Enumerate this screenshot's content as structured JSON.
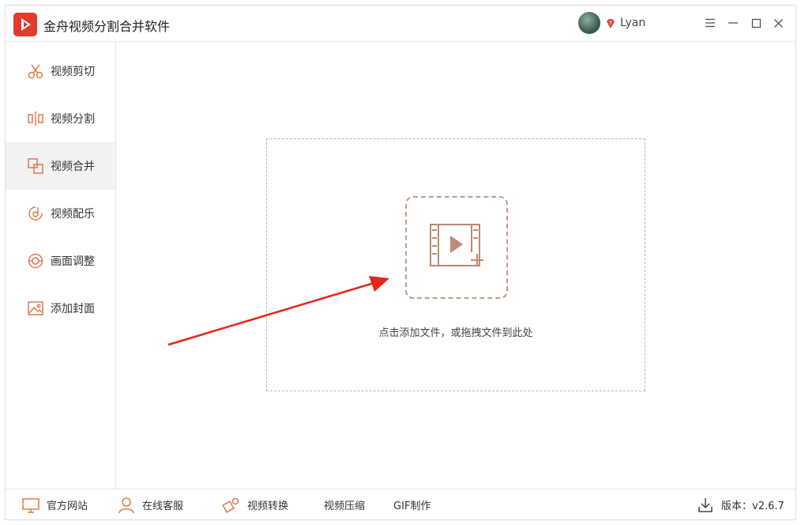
{
  "app": {
    "title": "金舟视频分割合并软件",
    "logo_icon": "play-logo-icon",
    "brand_color": "#e23a2c"
  },
  "user": {
    "name": "Lyan",
    "badge_icon": "vip-diamond-icon"
  },
  "window_controls": [
    "menu-icon",
    "minimize-icon",
    "maximize-icon",
    "close-icon"
  ],
  "sidebar": {
    "items": [
      {
        "label": "视频剪切",
        "icon": "scissors-icon"
      },
      {
        "label": "视频分割",
        "icon": "split-icon"
      },
      {
        "label": "视频合并",
        "icon": "merge-icon",
        "active": true
      },
      {
        "label": "视频配乐",
        "icon": "music-icon"
      },
      {
        "label": "画面调整",
        "icon": "adjust-icon"
      },
      {
        "label": "添加封面",
        "icon": "image-icon"
      }
    ]
  },
  "main": {
    "drop_hint": "点击添加文件，或拖拽文件到此处",
    "add_icon": "add-video-icon",
    "accent_color": "#c49a88"
  },
  "footer": {
    "website": "官方网站",
    "support": "在线客服",
    "convert": "视频转换",
    "compress": "视频压缩",
    "gif": "GIF制作",
    "version": "版本：v2.6.7"
  }
}
